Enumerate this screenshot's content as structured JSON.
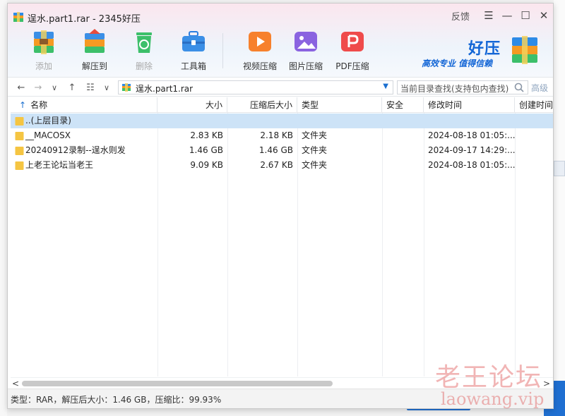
{
  "window": {
    "title": "逞水.part1.rar - 2345好压",
    "feedback": "反馈",
    "controls": {
      "menu": "☰",
      "minimize": "—",
      "maximize": "☐",
      "close": "✕"
    }
  },
  "toolbar": {
    "add": "添加",
    "extract": "解压到",
    "delete": "删除",
    "toolbox": "工具箱",
    "video": "视频压缩",
    "image": "图片压缩",
    "pdf": "PDF压缩"
  },
  "brand": {
    "name": "好压",
    "slogan": "高效专业  值得信赖"
  },
  "address": {
    "back_icon": "←",
    "forward_icon": "→",
    "history_icon": "∨",
    "up_icon": "↑",
    "view_icon": "☷",
    "view_dd_icon": "∨",
    "path": "逞水.part1.rar",
    "dropdown_icon": "▼",
    "search_placeholder": "当前目录查找(支持包内查找)",
    "advanced": "高级"
  },
  "table": {
    "headers": {
      "name": "名称",
      "size": "大小",
      "packed": "压缩后大小",
      "type": "类型",
      "security": "安全",
      "modified": "修改时间",
      "created": "创建时间"
    },
    "sort_icon": "↑",
    "rows": [
      {
        "name": "..(上层目录)",
        "size": "",
        "packed": "",
        "type": "",
        "security": "",
        "modified": "",
        "created": ""
      },
      {
        "name": "__MACOSX",
        "size": "2.83 KB",
        "packed": "2.18 KB",
        "type": "文件夹",
        "security": "",
        "modified": "2024-08-18 01:05:...",
        "created": ""
      },
      {
        "name": "20240912录制--逞水则发",
        "size": "1.46 GB",
        "packed": "1.46 GB",
        "type": "文件夹",
        "security": "",
        "modified": "2024-09-17 14:29:...",
        "created": ""
      },
      {
        "name": "上老王论坛当老王",
        "size": "9.09 KB",
        "packed": "2.67 KB",
        "type": "文件夹",
        "security": "",
        "modified": "2024-08-18 01:05:...",
        "created": ""
      }
    ]
  },
  "scroll": {
    "left": "<",
    "right": ">"
  },
  "status": "类型：RAR，解压后大小：1.46 GB，压缩比：99.93%",
  "watermark": {
    "line1": "老王论坛",
    "line2": "laowang.vip"
  },
  "colors": {
    "accent": "#1366d6",
    "selected_row": "#cde3f7",
    "folder": "#f5c542"
  }
}
